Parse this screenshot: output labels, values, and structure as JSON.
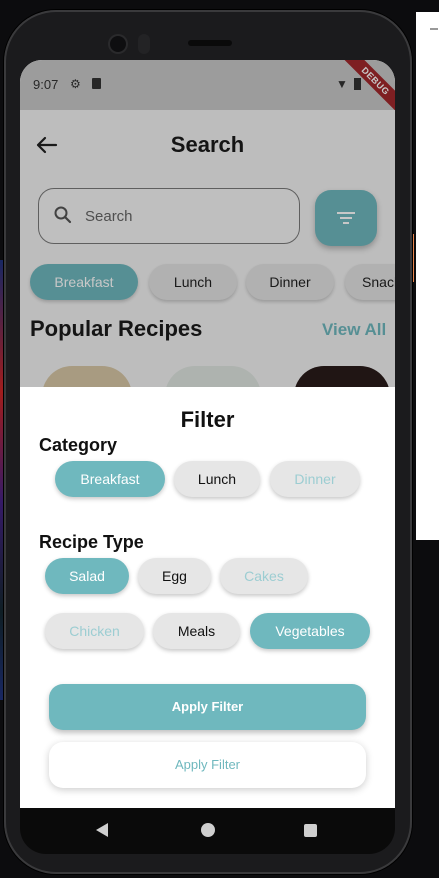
{
  "status_bar": {
    "time": "9:07",
    "debug_label": "DEBUG"
  },
  "app": {
    "title": "Search",
    "search": {
      "placeholder": "Search"
    },
    "categories": [
      "Breakfast",
      "Lunch",
      "Dinner",
      "Snacks"
    ],
    "section_title": "Popular Recipes",
    "view_all": "View All"
  },
  "filter_sheet": {
    "title": "Filter",
    "category_label": "Category",
    "category_options": [
      "Breakfast",
      "Lunch",
      "Dinner"
    ],
    "recipe_type_label": "Recipe Type",
    "recipe_type_row1": [
      "Salad",
      "Egg",
      "Cakes"
    ],
    "recipe_type_row2": [
      "Chicken",
      "Meals",
      "Vegetables"
    ],
    "apply_primary": "Apply Filter",
    "apply_secondary": "Apply Filter"
  },
  "colors": {
    "accent": "#6fb8be",
    "debug_banner": "#a2282c"
  },
  "icons": [
    "back-arrow-icon",
    "search-icon",
    "filter-icon",
    "settings-icon",
    "sd-card-icon",
    "wifi-icon",
    "battery-icon"
  ]
}
